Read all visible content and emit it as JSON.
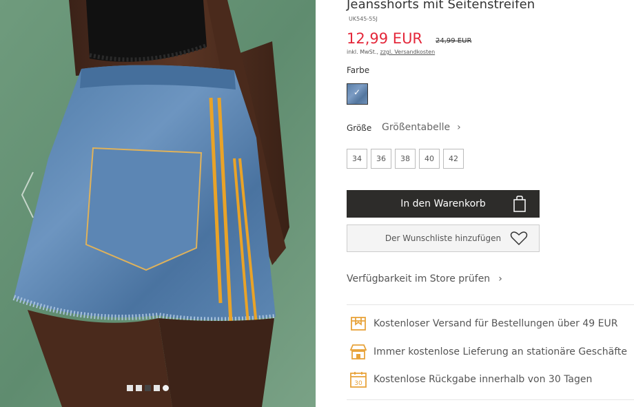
{
  "product": {
    "title": "Jeansshorts mit Seitenstreifen",
    "sku": "UK545-55J",
    "price": "12,99 EUR",
    "old_price": "24,99 EUR",
    "tax_prefix": "inkl. MwSt.,",
    "shipping_link": "zzgl. Versandkosten"
  },
  "color": {
    "label": "Farbe",
    "check": "✓"
  },
  "size": {
    "label": "Größe",
    "guide": "Größentabelle",
    "chevron": "›",
    "options": [
      "34",
      "36",
      "38",
      "40",
      "42"
    ]
  },
  "actions": {
    "add_to_cart": "In den Warenkorb",
    "wishlist": "Der Wunschliste hinzufügen",
    "store_check": "Verfügbarkeit im Store prüfen",
    "chevron": "›"
  },
  "benefits": [
    {
      "icon": "shipping-box-icon",
      "text": "Kostenloser Versand für Bestellungen über 49 EUR"
    },
    {
      "icon": "store-icon",
      "text": "Immer kostenlose Lieferung an stationäre Geschäfte"
    },
    {
      "icon": "calendar-30-icon",
      "text": "Kostenlose Rückgabe innerhalb von 30 Tagen"
    }
  ],
  "calendar_number": "30",
  "gallery": {
    "dots_count": 5,
    "active_index": 3
  },
  "colors": {
    "price_red": "#e4273a",
    "cart_bg": "#2d2c2a",
    "benefit_icon": "#e8a33a",
    "background_green": "#6f9b7d"
  }
}
